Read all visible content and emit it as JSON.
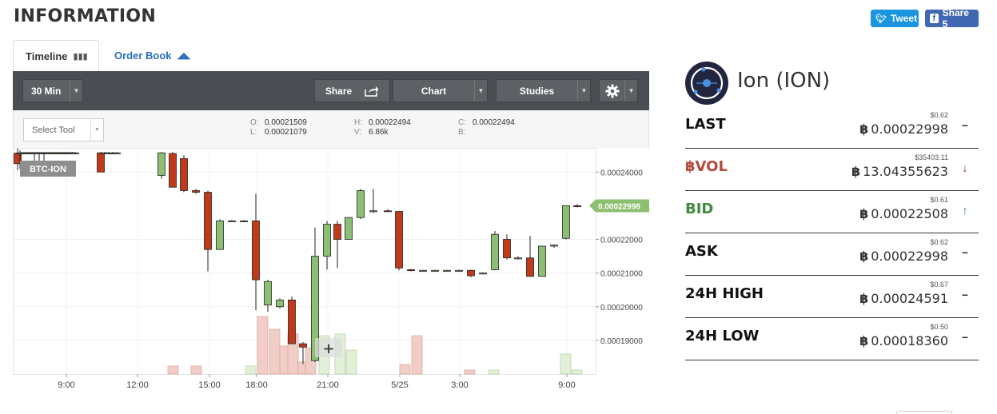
{
  "page": {
    "title": "INFORMATION"
  },
  "social": {
    "tweet_label": "Tweet",
    "share_label": "Share 5"
  },
  "tabs": [
    {
      "label": "Timeline",
      "icon": "bar-chart-icon",
      "active": true
    },
    {
      "label": "Order Book",
      "icon": "area-chart-icon",
      "active": false
    }
  ],
  "toolbar": {
    "interval": "30 Min",
    "share_label": "Share",
    "chart_label": "Chart",
    "studies_label": "Studies",
    "settings_icon": "gear-icon"
  },
  "ohlc": {
    "select_tool_placeholder": "Select Tool",
    "o": "0.00021509",
    "l": "0.00021079",
    "h": "0.00022494",
    "v": "6.86k",
    "c": "0.00022494",
    "b": "",
    "o_key": "O:",
    "l_key": "L:",
    "h_key": "H:",
    "v_key": "V:",
    "c_key": "C:",
    "b_key": "B:"
  },
  "chart_data": {
    "type": "candlestick",
    "pair_label": "BTC-ION",
    "current_price_label": "0.00022998",
    "x_ticks": [
      "9:00",
      "12:00",
      "15:00",
      "18:00",
      "21:00",
      "5/25",
      "3:00",
      "9:00"
    ],
    "y_ticks": [
      "0.00024000",
      "0.00022000",
      "0.00021000",
      "0.00020000",
      "0.00019000"
    ],
    "ylim": [
      0.00018,
      0.000246
    ],
    "colors": {
      "up": "#8cbf73",
      "down": "#c0391b",
      "vol_up": "#e2f0d9",
      "vol_down": "#f0cdc6",
      "price_tag": "#8cc06f"
    },
    "candles": [
      {
        "o": 0.0002456,
        "h": 0.000247,
        "l": 0.0002405,
        "c": 0.0002425
      },
      {
        "o": 0.0002457,
        "h": 0.0002465,
        "l": 0.000241,
        "c": 0.0002457
      },
      {
        "o": 0.0002457,
        "h": 0.000246,
        "l": 0.0002455,
        "c": 0.0002457
      },
      {
        "o": 0.0002457,
        "h": 0.000246,
        "l": 0.0002455,
        "c": 0.0002457
      },
      {
        "o": 0.0002457,
        "h": 0.000246,
        "l": 0.0002455,
        "c": 0.0002457
      },
      {
        "o": 0.0002457,
        "h": 0.000246,
        "l": 0.0002455,
        "c": 0.0002457
      },
      {
        "o": 0.0002457,
        "h": 0.000246,
        "l": 0.0002455,
        "c": 0.0002457
      },
      {
        "o": 0.0002457,
        "h": 0.000246,
        "l": 0.0002405,
        "c": 0.0002457
      },
      {
        "o": 0.0002457,
        "h": 0.000246,
        "l": 0.0002455,
        "c": 0.0002457
      },
      {
        "o": 0.0002457,
        "h": 0.000246,
        "l": 0.0002405,
        "c": 0.0002457
      },
      {
        "o": 0.0002457,
        "h": 0.000246,
        "l": 0.0002455,
        "c": 0.0002457
      },
      {
        "o": 0.0002457,
        "h": 0.000246,
        "l": 0.0002405,
        "c": 0.0002457
      },
      {
        "o": 0.0002457,
        "h": 0.000246,
        "l": 0.0002455,
        "c": 0.0002457
      },
      {
        "o": 0.0002457,
        "h": 0.000246,
        "l": 0.0002455,
        "c": 0.0002457
      },
      {
        "o": 0.0002457,
        "h": 0.000246,
        "l": 0.0002455,
        "c": 0.0002457
      },
      {
        "o": 0.0002457,
        "h": 0.000246,
        "l": 0.0002455,
        "c": 0.0002457
      },
      {
        "o": 0.0002457,
        "h": 0.000246,
        "l": 0.0002455,
        "c": 0.0002457
      },
      {
        "o": 0.0002457,
        "h": 0.000246,
        "l": 0.0002455,
        "c": 0.0002457
      },
      {
        "o": 0.0002457,
        "h": 0.000246,
        "l": 0.0002455,
        "c": 0.0002457
      },
      {
        "o": 0.0002457,
        "h": 0.000246,
        "l": 0.0002455,
        "c": 0.0002457
      },
      {
        "o": 0.0002457,
        "h": 0.000246,
        "l": 0.0002455,
        "c": 0.0002457
      },
      {
        "o": 0.0002457,
        "h": 0.000246,
        "l": 0.0002455,
        "c": 0.0002457
      },
      {
        "o": 0.0002457,
        "h": 0.000246,
        "l": 0.0002455,
        "c": 0.0002457
      },
      {
        "o": 0.0002457,
        "h": 0.000246,
        "l": 0.0002455,
        "c": 0.0002457
      },
      {
        "o": 0.0002457,
        "h": 0.000246,
        "l": 0.0002455,
        "c": 0.0002457
      },
      {
        "o": 0.0002457,
        "h": 0.000246,
        "l": 0.00024,
        "c": 0.00024
      },
      {
        "o": 0.0002457,
        "h": 0.000246,
        "l": 0.0002455,
        "c": 0.0002457
      },
      {
        "o": 0.0002457,
        "h": 0.000246,
        "l": 0.0002455,
        "c": 0.0002457
      },
      {
        "o": 0.0002455,
        "h": 0.000246,
        "l": 0.0002455,
        "c": 0.0002457
      },
      {
        "o": 0.0002455,
        "h": 0.000246,
        "l": 0.0002455,
        "c": 0.0002457
      },
      {
        "o": 0.000239,
        "h": 0.000246,
        "l": 0.000238,
        "c": 0.0002457
      },
      {
        "o": 0.0002455,
        "h": 0.000246,
        "l": 0.0002355,
        "c": 0.0002355
      },
      {
        "o": 0.000244,
        "h": 0.000245,
        "l": 0.000234,
        "c": 0.0002345
      },
      {
        "o": 0.0002345,
        "h": 0.000235,
        "l": 0.0002335,
        "c": 0.000234
      },
      {
        "o": 0.000234,
        "h": 0.0002345,
        "l": 0.0002105,
        "c": 0.000217
      },
      {
        "o": 0.000217,
        "h": 0.000226,
        "l": 0.000217,
        "c": 0.0002255
      },
      {
        "o": 0.0002255,
        "h": 0.0002258,
        "l": 0.0002252,
        "c": 0.0002255
      },
      {
        "o": 0.0002255,
        "h": 0.0002258,
        "l": 0.0002252,
        "c": 0.0002255
      },
      {
        "o": 0.0002255,
        "h": 0.0002335,
        "l": 0.000199,
        "c": 0.000208
      },
      {
        "o": 0.0002005,
        "h": 0.000208,
        "l": 0.0001985,
        "c": 0.0002075
      },
      {
        "o": 0.0002,
        "h": 0.0002025,
        "l": 0.0001995,
        "c": 0.000202
      },
      {
        "o": 0.000202,
        "h": 0.000203,
        "l": 0.00019,
        "c": 0.000189
      },
      {
        "o": 0.000189,
        "h": 0.0001895,
        "l": 0.000183,
        "c": 0.000188
      },
      {
        "o": 0.000184,
        "h": 0.0002235,
        "l": 0.0001836,
        "c": 0.000215
      },
      {
        "o": 0.000215,
        "h": 0.0002255,
        "l": 0.000211,
        "c": 0.0002245
      },
      {
        "o": 0.0002245,
        "h": 0.0002255,
        "l": 0.0002115,
        "c": 0.00022
      },
      {
        "o": 0.00022,
        "h": 0.0002265,
        "l": 0.00022,
        "c": 0.0002265
      },
      {
        "o": 0.0002265,
        "h": 0.000235,
        "l": 0.000226,
        "c": 0.0002345
      },
      {
        "o": 0.0002285,
        "h": 0.000235,
        "l": 0.0002278,
        "c": 0.0002285
      },
      {
        "o": 0.0002285,
        "h": 0.000229,
        "l": 0.0002282,
        "c": 0.0002283
      },
      {
        "o": 0.0002283,
        "h": 0.0002285,
        "l": 0.0002108,
        "c": 0.0002115
      },
      {
        "o": 0.000211,
        "h": 0.0002112,
        "l": 0.0002105,
        "c": 0.0002108
      },
      {
        "o": 0.0002108,
        "h": 0.000211,
        "l": 0.0002105,
        "c": 0.0002108
      },
      {
        "o": 0.0002108,
        "h": 0.000211,
        "l": 0.0002105,
        "c": 0.0002108
      },
      {
        "o": 0.0002108,
        "h": 0.000211,
        "l": 0.0002105,
        "c": 0.0002108
      },
      {
        "o": 0.0002108,
        "h": 0.000211,
        "l": 0.0002105,
        "c": 0.0002108
      },
      {
        "o": 0.0002108,
        "h": 0.000211,
        "l": 0.0002088,
        "c": 0.0002092
      },
      {
        "o": 0.00021,
        "h": 0.0002102,
        "l": 0.0002098,
        "c": 0.00021
      },
      {
        "o": 0.000211,
        "h": 0.0002225,
        "l": 0.0002108,
        "c": 0.0002215
      },
      {
        "o": 0.00022,
        "h": 0.0002215,
        "l": 0.000214,
        "c": 0.0002145
      },
      {
        "o": 0.0002145,
        "h": 0.000215,
        "l": 0.000214,
        "c": 0.0002145
      },
      {
        "o": 0.0002145,
        "h": 0.000221,
        "l": 0.000209,
        "c": 0.000209
      },
      {
        "o": 0.000209,
        "h": 0.000218,
        "l": 0.000209,
        "c": 0.000218
      },
      {
        "o": 0.000218,
        "h": 0.0002185,
        "l": 0.0002175,
        "c": 0.0002183
      },
      {
        "o": 0.0002203,
        "h": 0.00023,
        "l": 0.00022,
        "c": 0.00023
      },
      {
        "o": 0.00023,
        "h": 0.0002305,
        "l": 0.0002295,
        "c": 0.0002298
      }
    ]
  },
  "coin": {
    "name": "Ion (ION)",
    "logo_icon": "ion-logo-icon"
  },
  "stats": [
    {
      "label": "LAST",
      "usd": "$0.62",
      "btc": "0.00022998",
      "trend": "flat",
      "label_color": "#111111"
    },
    {
      "label": "฿VOL",
      "usd": "$35403.11",
      "btc": "13.04355623",
      "trend": "down",
      "label_color": "#b5483b"
    },
    {
      "label": "BID",
      "usd": "$0.61",
      "btc": "0.00022508",
      "trend": "up",
      "label_color": "#3f8a3f"
    },
    {
      "label": "ASK",
      "usd": "$0.62",
      "btc": "0.00022998",
      "trend": "flat",
      "label_color": "#111111"
    },
    {
      "label": "24H HIGH",
      "usd": "$0.67",
      "btc": "0.00024591",
      "trend": "flat",
      "label_color": "#111111"
    },
    {
      "label": "24H LOW",
      "usd": "$0.50",
      "btc": "0.00018360",
      "trend": "flat",
      "label_color": "#111111"
    }
  ],
  "btc_symbol": "฿",
  "trend_glyphs": {
    "flat": "−",
    "up": "↑",
    "down": "↓"
  },
  "trend_colors": {
    "flat": "#333333",
    "up": "#2f7d32",
    "down": "#8b2a1a"
  }
}
